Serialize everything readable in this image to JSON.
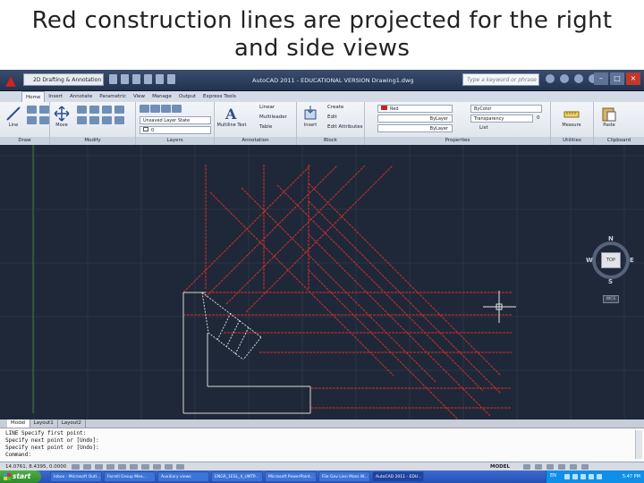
{
  "slide": {
    "title_line1": "Red construction lines are projected for the right",
    "title_line2": "and side views"
  },
  "titlebar": {
    "workspace": "2D Drafting & Annotation",
    "window_title": "AutoCAD 2011 - EDUCATIONAL VERSION   Drawing1.dwg",
    "help_search_placeholder": "Type a keyword or phrase",
    "icons": [
      "application-menu-icon",
      "quick-access-toolbar-icon",
      "search-icon",
      "help-icon"
    ]
  },
  "ribbon": {
    "tabs": [
      "Home",
      "Insert",
      "Annotate",
      "Parametric",
      "View",
      "Manage",
      "Output",
      "Express Tools"
    ],
    "active_tab": "Home",
    "panels": {
      "draw": "Draw",
      "modify": "Modify",
      "layers": "Layers",
      "annotation": "Annotation",
      "block": "Block",
      "properties": "Properties",
      "utilities": "Utilities",
      "clipboard": "Clipboard"
    },
    "tools": {
      "line": "Line",
      "move": "Move",
      "multiline_text": "Multiline Text",
      "insert": "Insert",
      "measure": "Measure",
      "paste": "Paste"
    },
    "annotation_items": [
      "Linear",
      "Multileader",
      "Table"
    ],
    "block_items": [
      "Create",
      "Edit",
      "Edit Attributes"
    ],
    "layer_state": "Unsaved Layer State",
    "current_layer": "0",
    "color_value": "Red",
    "linetype_value": "ByLayer",
    "lineweight_value": "ByLayer",
    "bycolor_value": "ByColor",
    "transparency_label": "Transparency",
    "transparency_value": "0",
    "list_label": "List",
    "accent_color": "#cc2020"
  },
  "viewcube": {
    "north": "N",
    "south": "S",
    "east": "E",
    "west": "W",
    "face": "TOP",
    "wcs": "WCS"
  },
  "layout_tabs": [
    "Model",
    "Layout1",
    "Layout2"
  ],
  "active_layout": "Model",
  "command_line": [
    "LINE Specify first point:",
    "Specify next point or [Undo]:",
    "Specify next point or [Undo]:",
    "Command:"
  ],
  "status": {
    "coordinates": "14.0761, 8.4395, 0.0000",
    "model_label": "MODEL"
  },
  "taskbar": {
    "start_label": "start",
    "buttons": [
      "Inbox - Microsoft Outl...",
      "Farrell Group Mea...",
      "Auxiliary views",
      "ENGR_1ESL_4_UNTP...",
      "Microsoft PowerPoint...",
      "File Gov Lien Mass W...",
      "AutoCAD 2011 - EDU..."
    ],
    "active_button": 6,
    "lang": "EN",
    "clock": "5:47 PM"
  },
  "drawing": {
    "background": "#1f2838",
    "construction_line_color": "#d03030",
    "object_line_color": "#d8d8d8"
  }
}
